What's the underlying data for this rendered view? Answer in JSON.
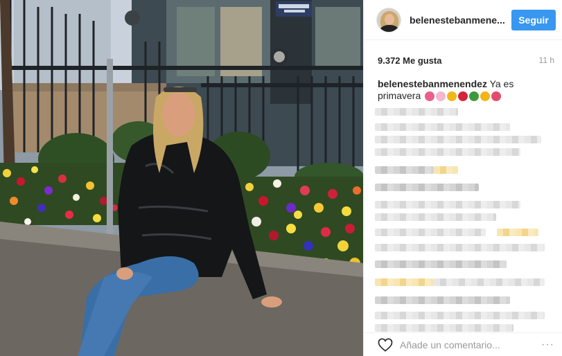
{
  "post": {
    "username": "belenestebanmene...",
    "follow_label": "Seguir",
    "likes": "9.372 Me gusta",
    "time_ago": "11 h",
    "caption_user": "belenestebanmenendez",
    "caption_text": "Ya es primavera",
    "caption_emojis": [
      "tulip",
      "cherry-blossom",
      "sunflower",
      "rose",
      "four-leaf-clover",
      "sunflower",
      "hibiscus"
    ],
    "comment_placeholder": "Añade un comentario...",
    "more_label": "···"
  },
  "colors": {
    "accent": "#3897f0",
    "text": "#262626",
    "muted": "#999999"
  },
  "icons": {
    "like": "heart-icon",
    "more": "more-options-icon"
  }
}
